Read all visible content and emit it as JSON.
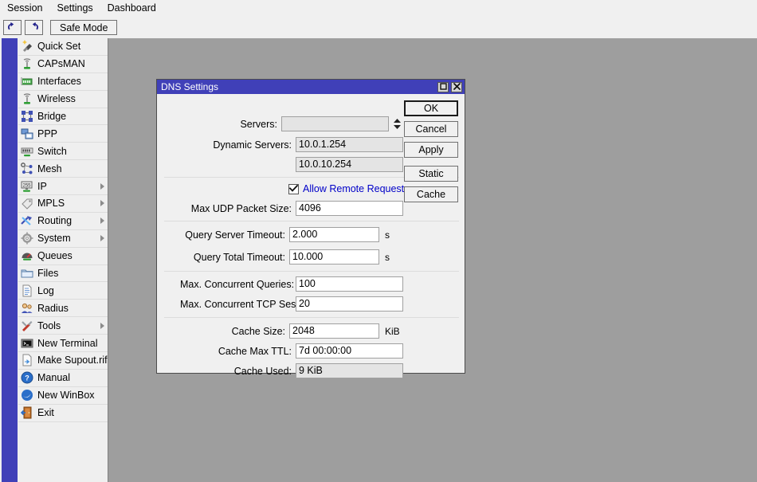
{
  "menubar": {
    "items": [
      {
        "label": "Session"
      },
      {
        "label": "Settings"
      },
      {
        "label": "Dashboard"
      }
    ]
  },
  "toolbar": {
    "undo_icon": "undo-arrow-icon",
    "redo_icon": "redo-arrow-icon",
    "safe_mode_label": "Safe Mode"
  },
  "sidebar": {
    "items": [
      {
        "label": "Quick Set",
        "icon": "magic-wand-icon",
        "submenu": false
      },
      {
        "label": "CAPsMAN",
        "icon": "antenna-icon",
        "submenu": false
      },
      {
        "label": "Interfaces",
        "icon": "network-card-icon",
        "submenu": false
      },
      {
        "label": "Wireless",
        "icon": "antenna-icon",
        "submenu": false
      },
      {
        "label": "Bridge",
        "icon": "bridge-nodes-icon",
        "submenu": false
      },
      {
        "label": "PPP",
        "icon": "computers-link-icon",
        "submenu": false
      },
      {
        "label": "Switch",
        "icon": "switch-icon",
        "submenu": false
      },
      {
        "label": "Mesh",
        "icon": "mesh-nodes-icon",
        "submenu": false
      },
      {
        "label": "IP",
        "icon": "ip-255-icon",
        "submenu": true
      },
      {
        "label": "MPLS",
        "icon": "tags-icon",
        "submenu": true
      },
      {
        "label": "Routing",
        "icon": "routing-arrows-icon",
        "submenu": true
      },
      {
        "label": "System",
        "icon": "gear-icon",
        "submenu": true
      },
      {
        "label": "Queues",
        "icon": "gauge-icon",
        "submenu": false
      },
      {
        "label": "Files",
        "icon": "folder-icon",
        "submenu": false
      },
      {
        "label": "Log",
        "icon": "document-lines-icon",
        "submenu": false
      },
      {
        "label": "Radius",
        "icon": "users-icon",
        "submenu": false
      },
      {
        "label": "Tools",
        "icon": "tools-icon",
        "submenu": true
      },
      {
        "label": "New Terminal",
        "icon": "terminal-icon",
        "submenu": false
      },
      {
        "label": "Make Supout.rif",
        "icon": "file-export-icon",
        "submenu": false
      },
      {
        "label": "Manual",
        "icon": "help-question-icon",
        "submenu": false
      },
      {
        "label": "New WinBox",
        "icon": "winbox-swirl-icon",
        "submenu": false
      },
      {
        "label": "Exit",
        "icon": "door-exit-icon",
        "submenu": false
      }
    ]
  },
  "dialog": {
    "title": "DNS Settings",
    "titlebar_buttons": [
      {
        "name": "maximize-button",
        "glyph": "maximize-icon"
      },
      {
        "name": "close-button",
        "glyph": "close-icon"
      }
    ],
    "fields": {
      "servers": {
        "label": "Servers:",
        "value": "",
        "readonly": true,
        "spinner": true
      },
      "dynamic_servers": {
        "label": "Dynamic Servers:",
        "value": "10.0.1.254",
        "readonly": true
      },
      "dynamic_servers_2": {
        "label": "",
        "value": "10.0.10.254",
        "readonly": true
      },
      "allow_remote_requests": {
        "label": "Allow Remote Requests",
        "checked": true
      },
      "max_udp_packet_size": {
        "label": "Max UDP Packet Size:",
        "value": "4096",
        "readonly": false
      },
      "query_server_timeout": {
        "label": "Query Server Timeout:",
        "value": "2.000",
        "unit": "s",
        "readonly": false
      },
      "query_total_timeout": {
        "label": "Query Total Timeout:",
        "value": "10.000",
        "unit": "s",
        "readonly": false
      },
      "max_concurrent_queries": {
        "label": "Max. Concurrent Queries:",
        "value": "100",
        "readonly": false
      },
      "max_concurrent_tcp_sessions": {
        "label": "Max. Concurrent TCP Sessions:",
        "value": "20",
        "readonly": false
      },
      "cache_size": {
        "label": "Cache Size:",
        "value": "2048",
        "unit": "KiB",
        "readonly": false
      },
      "cache_max_ttl": {
        "label": "Cache Max TTL:",
        "value": "7d 00:00:00",
        "readonly": false
      },
      "cache_used": {
        "label": "Cache Used:",
        "value": "9 KiB",
        "readonly": true
      }
    },
    "buttons": [
      {
        "label": "OK",
        "primary": true
      },
      {
        "label": "Cancel",
        "primary": false
      },
      {
        "label": "Apply",
        "primary": false
      },
      {
        "label": "Static",
        "primary": false
      },
      {
        "label": "Cache",
        "primary": false
      }
    ]
  },
  "colors": {
    "accent_blue": "#4040b8",
    "window_gray": "#9e9e9e",
    "panel_gray": "#f0f0f0",
    "sidebar_gray": "#efefef",
    "link_blue": "#0000c8",
    "readonly_field": "#e4e4e4"
  }
}
